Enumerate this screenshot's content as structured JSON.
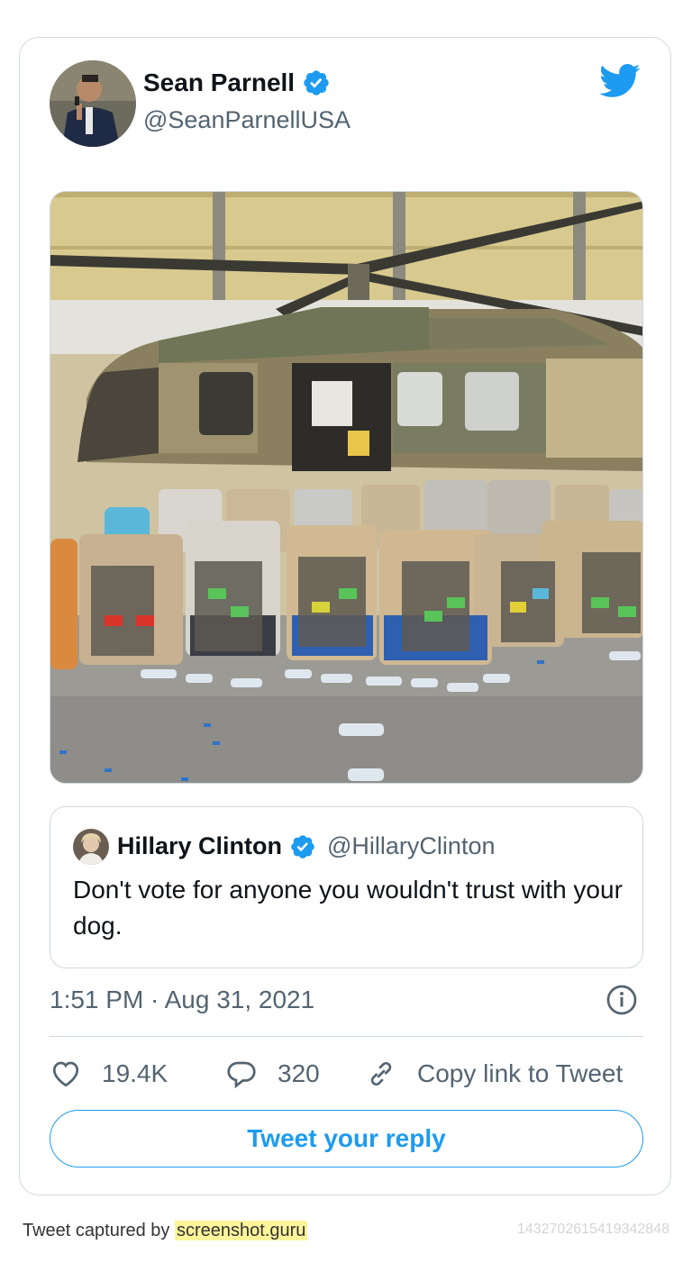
{
  "tweet": {
    "author_name": "Sean Parnell",
    "author_handle": "@SeanParnellUSA",
    "timestamp": "1:51 PM · Aug 31, 2021"
  },
  "quoted": {
    "author_name": "Hillary Clinton",
    "author_handle": "@HillaryClinton",
    "text": "Don't vote for anyone you wouldn't trust with your dog."
  },
  "actions": {
    "likes": "19.4K",
    "replies": "320",
    "copy_link": "Copy link to Tweet"
  },
  "reply_button": "Tweet your reply",
  "footer": {
    "prefix": "Tweet captured by ",
    "link": "screenshot.guru",
    "tweet_id": "1432702615419342848"
  },
  "colors": {
    "accent": "#1d9bf0",
    "muted": "#536471",
    "border": "#cfd9de",
    "highlight": "#fff59b"
  },
  "icons": [
    "verified-badge-icon",
    "twitter-bird-icon",
    "info-icon",
    "heart-icon",
    "reply-bubble-icon",
    "link-icon"
  ]
}
